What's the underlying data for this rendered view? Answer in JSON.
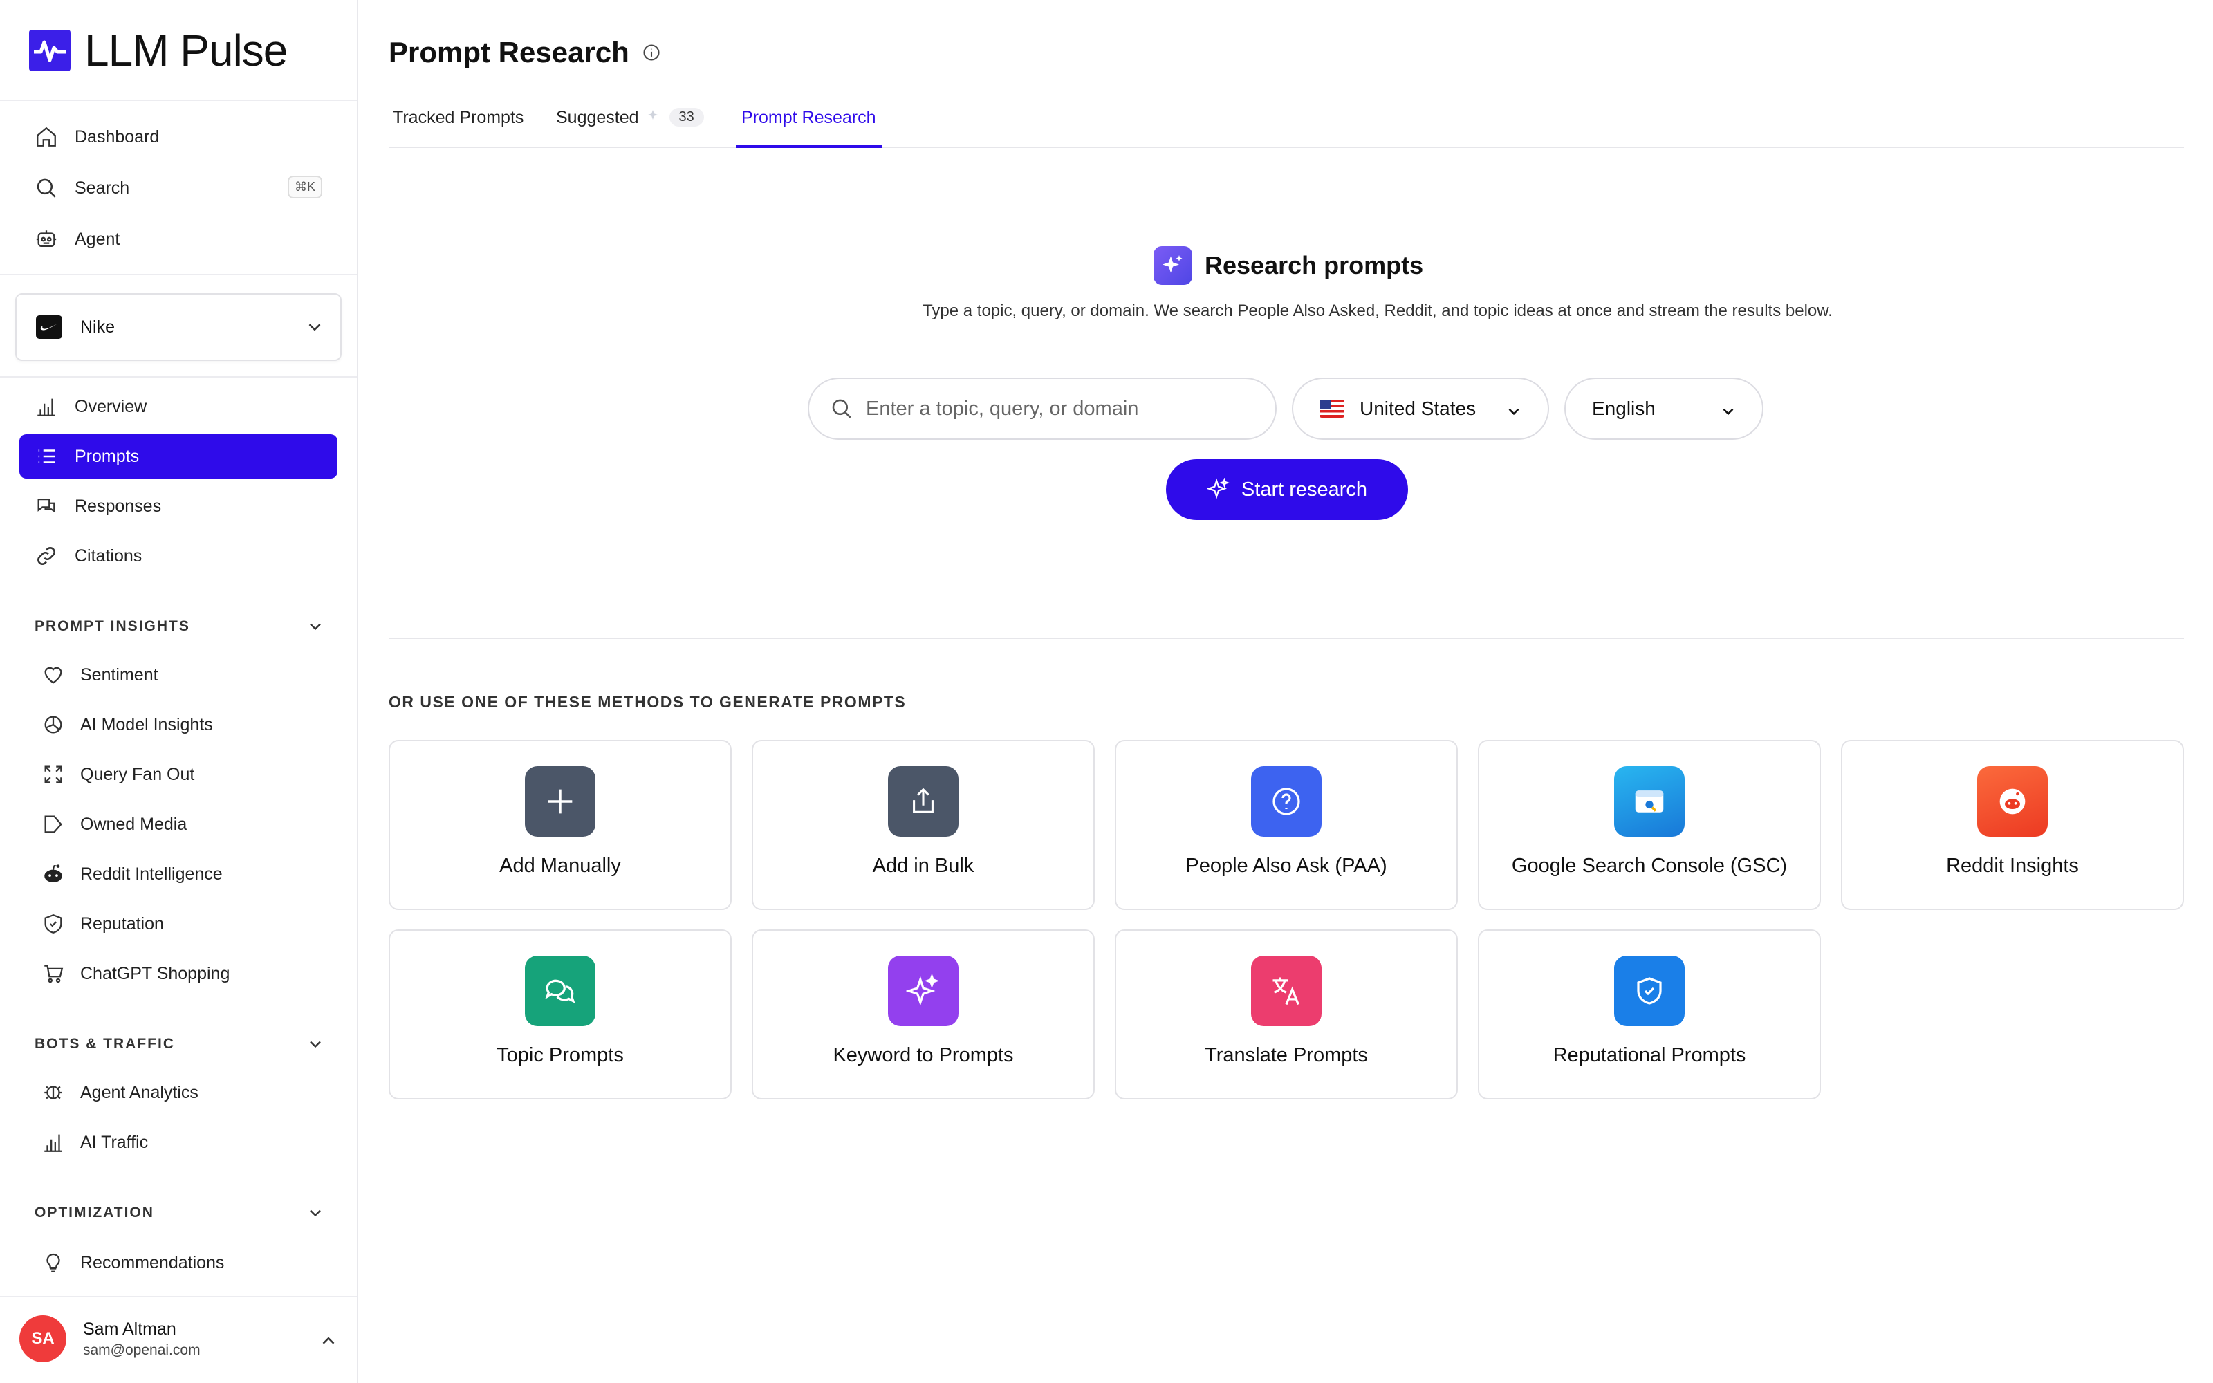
{
  "app": {
    "name": "LLM Pulse"
  },
  "sidebar": {
    "top_items": [
      {
        "label": "Dashboard",
        "icon": "home-icon"
      },
      {
        "label": "Search",
        "icon": "search-icon",
        "shortcut": "⌘K"
      },
      {
        "label": "Agent",
        "icon": "robot-icon"
      }
    ],
    "brand": {
      "name": "Nike"
    },
    "main_items": [
      {
        "label": "Overview",
        "icon": "bar-chart-icon"
      },
      {
        "label": "Prompts",
        "icon": "list-icon",
        "active": true
      },
      {
        "label": "Responses",
        "icon": "chat-icon"
      },
      {
        "label": "Citations",
        "icon": "link-icon"
      }
    ],
    "sections": [
      {
        "title": "PROMPT INSIGHTS",
        "items": [
          {
            "label": "Sentiment",
            "icon": "heart-icon"
          },
          {
            "label": "AI Model Insights",
            "icon": "pie-icon"
          },
          {
            "label": "Query Fan Out",
            "icon": "expand-icon"
          },
          {
            "label": "Owned Media",
            "icon": "tag-icon"
          },
          {
            "label": "Reddit Intelligence",
            "icon": "reddit-icon"
          },
          {
            "label": "Reputation",
            "icon": "shield-icon"
          },
          {
            "label": "ChatGPT Shopping",
            "icon": "cart-icon"
          }
        ]
      },
      {
        "title": "BOTS & TRAFFIC",
        "items": [
          {
            "label": "Agent Analytics",
            "icon": "bug-icon"
          },
          {
            "label": "AI Traffic",
            "icon": "bar-chart-icon"
          }
        ]
      },
      {
        "title": "OPTIMIZATION",
        "items": [
          {
            "label": "Recommendations",
            "icon": "lightbulb-icon"
          }
        ]
      }
    ],
    "user": {
      "initials": "SA",
      "name": "Sam Altman",
      "email": "sam@openai.com"
    }
  },
  "page": {
    "title": "Prompt Research",
    "tabs": [
      {
        "label": "Tracked Prompts"
      },
      {
        "label": "Suggested",
        "badge": "33"
      },
      {
        "label": "Prompt Research",
        "active": true
      }
    ]
  },
  "research": {
    "title": "Research prompts",
    "description": "Type a topic, query, or domain. We search People Also Asked, Reddit, and topic ideas at once and stream the results below.",
    "input_placeholder": "Enter a topic, query, or domain",
    "country": "United States",
    "language": "English",
    "start_label": "Start research"
  },
  "methods": {
    "heading": "OR USE ONE OF THESE METHODS TO GENERATE PROMPTS",
    "cards": [
      {
        "label": "Add Manually",
        "icon": "plus-icon",
        "color": "#4b5668"
      },
      {
        "label": "Add in Bulk",
        "icon": "upload-icon",
        "color": "#4b5668"
      },
      {
        "label": "People Also Ask (PAA)",
        "icon": "question-icon",
        "color": "#3d63f0"
      },
      {
        "label": "Google Search Console (GSC)",
        "icon": "console-icon",
        "color": "#1da1e6"
      },
      {
        "label": "Reddit Insights",
        "icon": "reddit-icon",
        "color": "#f4512b"
      },
      {
        "label": "Topic Prompts",
        "icon": "chat-bubbles-icon",
        "color": "#16a37a"
      },
      {
        "label": "Keyword to Prompts",
        "icon": "sparkles-icon",
        "color": "#9340ee"
      },
      {
        "label": "Translate Prompts",
        "icon": "translate-icon",
        "color": "#ec3d6e"
      },
      {
        "label": "Reputational Prompts",
        "icon": "shield-check-icon",
        "color": "#1a7fe8"
      }
    ]
  }
}
